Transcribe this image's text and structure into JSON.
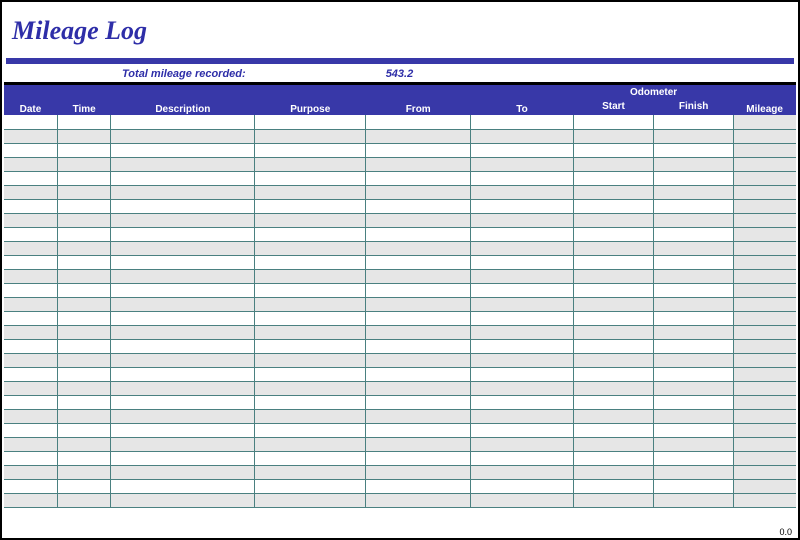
{
  "title": "Mileage Log",
  "summary": {
    "label": "Total mileage recorded:",
    "value": "543.2"
  },
  "columns": {
    "date": "Date",
    "time": "Time",
    "description": "Description",
    "purpose": "Purpose",
    "from": "From",
    "to": "To",
    "odometer_group": "Odometer",
    "start": "Start",
    "finish": "Finish",
    "mileage": "Mileage"
  },
  "row_count": 28,
  "footer_total": "0.0"
}
